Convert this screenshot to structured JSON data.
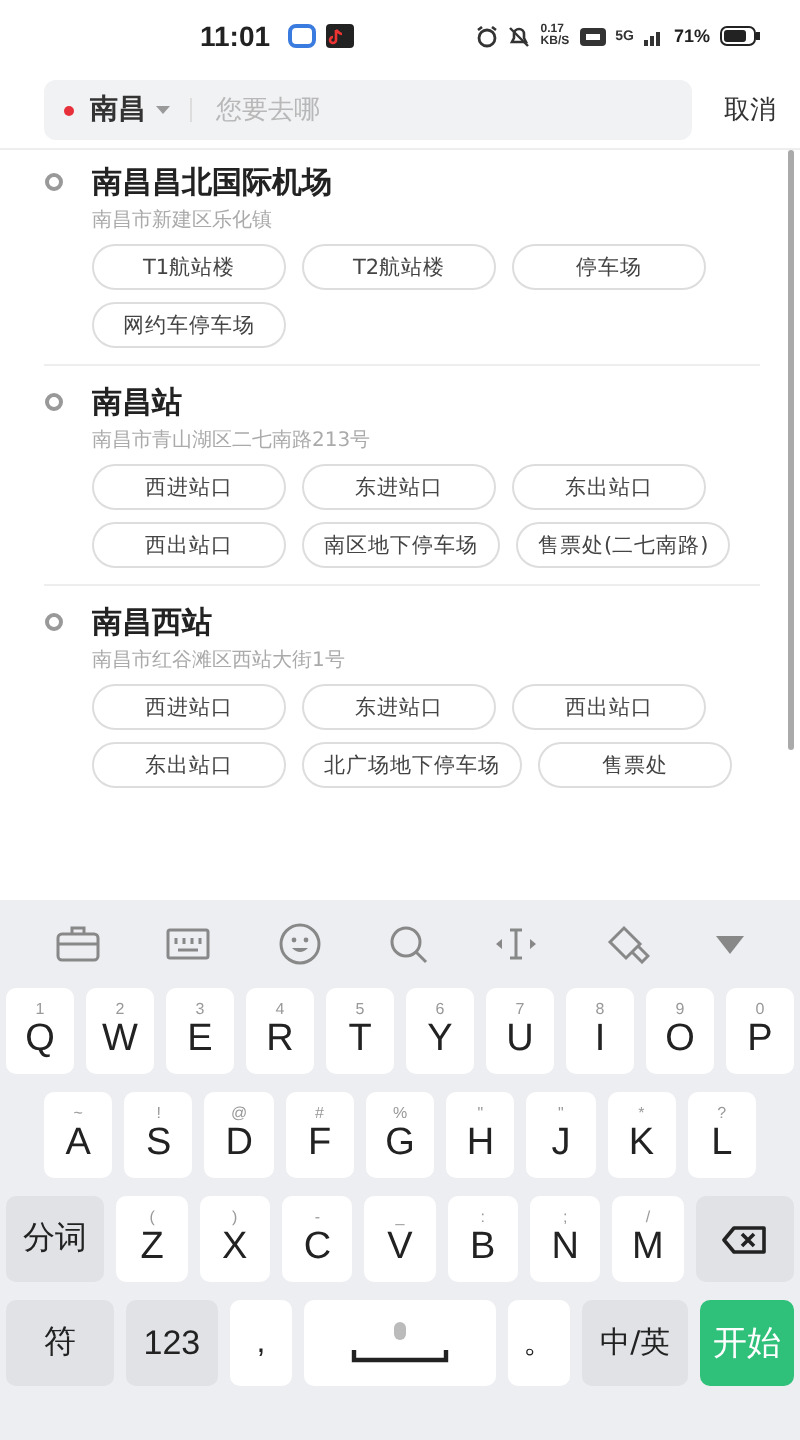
{
  "status_bar": {
    "time": "11:01",
    "net_speed_value": "0.17",
    "net_speed_unit": "KB/S",
    "signal_label": "5G",
    "battery": "71%"
  },
  "search": {
    "city": "南昌",
    "placeholder": "您要去哪",
    "cancel": "取消"
  },
  "places": [
    {
      "name": "南昌昌北国际机场",
      "address": "南昌市新建区乐化镇",
      "entrances": [
        "T1航站楼",
        "T2航站楼",
        "停车场",
        "网约车停车场"
      ]
    },
    {
      "name": "南昌站",
      "address": "南昌市青山湖区二七南路213号",
      "entrances": [
        "西进站口",
        "东进站口",
        "东出站口",
        "西出站口",
        "南区地下停车场",
        "售票处(二七南路)"
      ]
    },
    {
      "name": "南昌西站",
      "address": "南昌市红谷滩区西站大街1号",
      "entrances": [
        "西进站口",
        "东进站口",
        "西出站口",
        "东出站口",
        "北广场地下停车场",
        "售票处"
      ]
    }
  ],
  "keyboard": {
    "rows": [
      [
        {
          "hint": "1",
          "label": "Q"
        },
        {
          "hint": "2",
          "label": "W"
        },
        {
          "hint": "3",
          "label": "E"
        },
        {
          "hint": "4",
          "label": "R"
        },
        {
          "hint": "5",
          "label": "T"
        },
        {
          "hint": "6",
          "label": "Y"
        },
        {
          "hint": "7",
          "label": "U"
        },
        {
          "hint": "8",
          "label": "I"
        },
        {
          "hint": "9",
          "label": "O"
        },
        {
          "hint": "0",
          "label": "P"
        }
      ],
      [
        {
          "hint": "~",
          "label": "A"
        },
        {
          "hint": "!",
          "label": "S"
        },
        {
          "hint": "@",
          "label": "D"
        },
        {
          "hint": "#",
          "label": "F"
        },
        {
          "hint": "%",
          "label": "G"
        },
        {
          "hint": "\"",
          "label": "H"
        },
        {
          "hint": "\"",
          "label": "J"
        },
        {
          "hint": "*",
          "label": "K"
        },
        {
          "hint": "?",
          "label": "L"
        }
      ],
      [
        {
          "hint": "(",
          "label": "Z"
        },
        {
          "hint": ")",
          "label": "X"
        },
        {
          "hint": "-",
          "label": "C"
        },
        {
          "hint": "_",
          "label": "V"
        },
        {
          "hint": ":",
          "label": "B"
        },
        {
          "hint": ";",
          "label": "N"
        },
        {
          "hint": "/",
          "label": "M"
        }
      ]
    ],
    "segment_key": "分词",
    "symbols_key": "符",
    "numbers_key": "123",
    "comma_key": ",",
    "period_key": "。",
    "lang_key": "中/英",
    "go_key": "开始"
  }
}
